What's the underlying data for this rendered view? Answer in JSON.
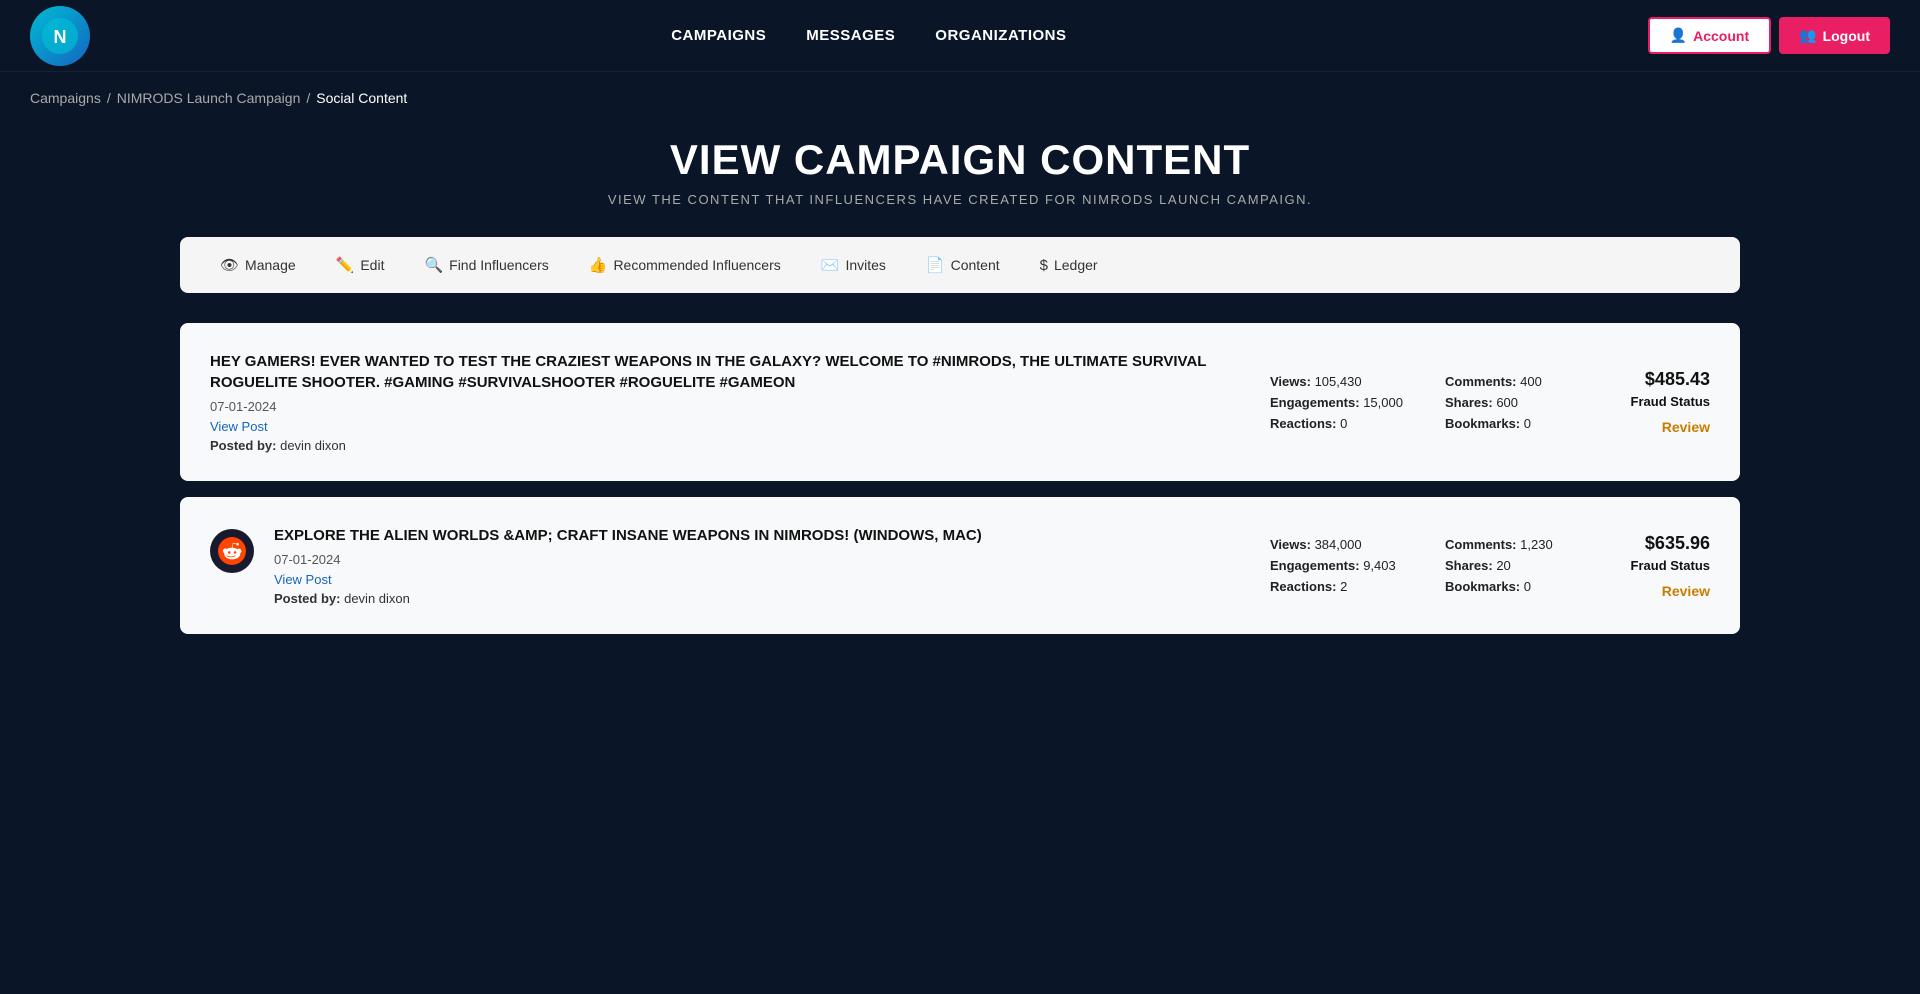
{
  "navbar": {
    "logo_text": "N",
    "links": [
      {
        "label": "CAMPAIGNS",
        "name": "nav-campaigns"
      },
      {
        "label": "MESSAGES",
        "name": "nav-messages"
      },
      {
        "label": "ORGANIZATIONS",
        "name": "nav-organizations"
      }
    ],
    "account_label": "Account",
    "logout_label": "Logout"
  },
  "breadcrumb": {
    "items": [
      {
        "label": "Campaigns",
        "name": "breadcrumb-campaigns"
      },
      {
        "label": "NIMRODS Launch Campaign",
        "name": "breadcrumb-campaign"
      },
      {
        "label": "Social Content",
        "name": "breadcrumb-social-content",
        "active": true
      }
    ],
    "separator": "/"
  },
  "page_header": {
    "title": "VIEW CAMPAIGN CONTENT",
    "subtitle": "VIEW THE CONTENT THAT INFLUENCERS HAVE CREATED FOR NIMRODS LAUNCH CAMPAIGN."
  },
  "tabs": [
    {
      "label": "Manage",
      "icon": "👁",
      "name": "tab-manage"
    },
    {
      "label": "Edit",
      "icon": "✏️",
      "name": "tab-edit"
    },
    {
      "label": "Find Influencers",
      "icon": "🔍",
      "name": "tab-find-influencers"
    },
    {
      "label": "Recommended Influencers",
      "icon": "👍",
      "name": "tab-recommended"
    },
    {
      "label": "Invites",
      "icon": "✉️",
      "name": "tab-invites"
    },
    {
      "label": "Content",
      "icon": "📄",
      "name": "tab-content"
    },
    {
      "label": "Ledger",
      "icon": "$",
      "name": "tab-ledger"
    }
  ],
  "content_cards": [
    {
      "id": "card-1",
      "icon_type": "fire",
      "icon_emoji": "🔥",
      "title": "🔥 HEY GAMERS! EVER WANTED TO TEST THE CRAZIEST WEAPONS IN THE GALAXY? WELCOME TO #NIMRODS, THE ULTIMATE SURVIVAL ROGUELITE SHOOTER. #GAMING #SURVIVALSHOOTER #ROGUELITE #GAMEON",
      "title_plain": "HEY GAMERS! EVER WANTED TO TEST THE CRAZIEST WEAPONS IN THE GALAXY? WELCOME TO #NIMRODS, THE ULTIMATE SURVIVAL ROGUELITE SHOOTER. #GAMING #SURVIVALSHOOTER #ROGUELITE #GAMEON",
      "date": "07-01-2024",
      "view_post_label": "View Post",
      "posted_by_label": "Posted by:",
      "posted_by_name": "devin dixon",
      "stats": [
        {
          "label": "Views:",
          "value": "105,430"
        },
        {
          "label": "Comments:",
          "value": "400"
        },
        {
          "label": "Engagements:",
          "value": "15,000"
        },
        {
          "label": "Shares:",
          "value": "600"
        },
        {
          "label": "Reactions:",
          "value": "0"
        },
        {
          "label": "Bookmarks:",
          "value": "0"
        }
      ],
      "amount": "$485.43",
      "fraud_status": "Fraud Status",
      "review_label": "Review"
    },
    {
      "id": "card-2",
      "icon_type": "reddit",
      "icon_emoji": "reddit",
      "title": "EXPLORE THE ALIEN WORLDS &AMP; CRAFT INSANE WEAPONS IN NIMRODS! (WINDOWS, MAC)",
      "title_plain": "EXPLORE THE ALIEN WORLDS &AMP; CRAFT INSANE WEAPONS IN NIMRODS! (WINDOWS, MAC)",
      "date": "07-01-2024",
      "view_post_label": "View Post",
      "posted_by_label": "Posted by:",
      "posted_by_name": "devin dixon",
      "stats": [
        {
          "label": "Views:",
          "value": "384,000"
        },
        {
          "label": "Comments:",
          "value": "1,230"
        },
        {
          "label": "Engagements:",
          "value": "9,403"
        },
        {
          "label": "Shares:",
          "value": "20"
        },
        {
          "label": "Reactions:",
          "value": "2"
        },
        {
          "label": "Bookmarks:",
          "value": "0"
        }
      ],
      "amount": "$635.96",
      "fraud_status": "Fraud Status",
      "review_label": "Review"
    }
  ]
}
